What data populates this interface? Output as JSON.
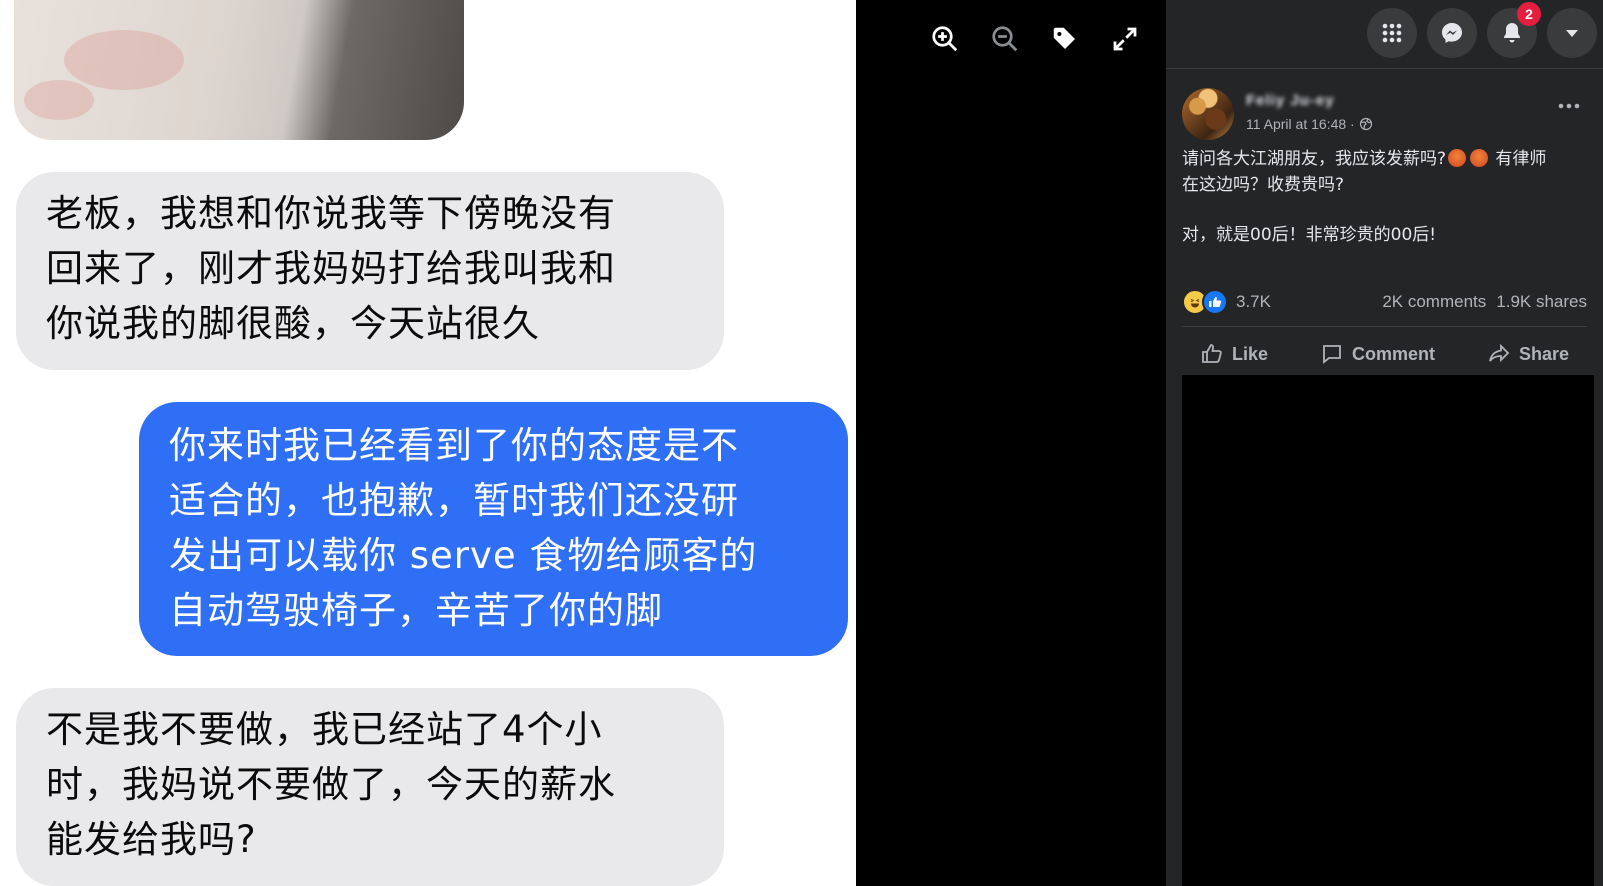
{
  "chat": {
    "messages": [
      {
        "side": "received",
        "text": "老板，我想和你说我等下傍晚没有\n回来了，刚才我妈妈打给我叫我和\n你说我的脚很酸，今天站很久"
      },
      {
        "side": "sent",
        "text": "你来时我已经看到了你的态度是不\n适合的，也抱歉，暂时我们还没研\n发出可以载你 serve 食物给顾客的\n自动驾驶椅子，辛苦了你的脚"
      },
      {
        "side": "received",
        "text": "不是我不要做，我已经站了4个小\n时，我妈说不要做了，今天的薪水\n能发给我吗?"
      }
    ],
    "colors": {
      "received_bubble": "#e9e9eb",
      "sent_bubble": "#2f6ff5"
    }
  },
  "viewer_tools": [
    "zoom-in-icon",
    "zoom-out-icon",
    "tag-icon",
    "fullscreen-icon"
  ],
  "topnav": {
    "icons": [
      "menu-grid-icon",
      "messenger-icon",
      "bell-icon",
      "caret-down-icon"
    ],
    "notification_count": "2"
  },
  "post": {
    "author": "Feliy Ju-ey",
    "timestamp": "11 April at 16:48 ·",
    "line1_a": "请问各大江湖朋友，我应该发薪吗?",
    "line1_b": " 有律师",
    "line2": "在这边吗？收费贵吗?",
    "line3": "对，就是00后！非常珍贵的00后!",
    "reactions_count": "3.7K",
    "comments": "2K comments",
    "shares": "1.9K shares",
    "actions": {
      "like": "Like",
      "comment": "Comment",
      "share": "Share"
    }
  },
  "colors": {
    "panel_bg": "#242526",
    "badge": "#e41e3f",
    "like_blue": "#1877f2"
  }
}
